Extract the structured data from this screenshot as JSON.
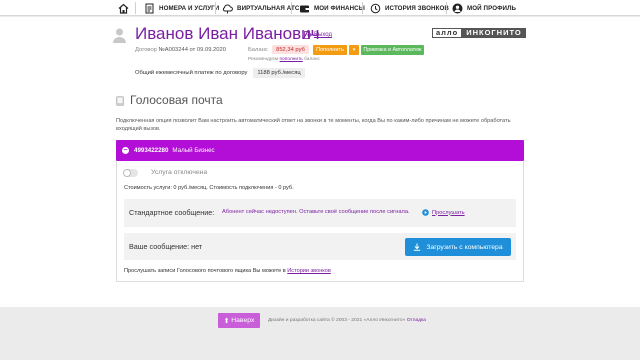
{
  "nav": {
    "home_icon": "home-icon",
    "items": [
      {
        "label": "НОМЕРА И УСЛУГИ",
        "icon": "document-icon"
      },
      {
        "label": "ВИРТУАЛЬНАЯ АТС",
        "icon": "cloud-icon"
      },
      {
        "label": "МОИ ФИНАНСЫ",
        "icon": "wallet-icon"
      },
      {
        "label": "ИСТОРИЯ ЗВОНКОВ",
        "icon": "clock-icon"
      },
      {
        "label": "МОЙ ПРОФИЛЬ",
        "icon": "user-icon"
      }
    ]
  },
  "user": {
    "name": "Иванов Иван Иванович",
    "logout": "Выход",
    "contract_label": "Договор",
    "contract_value": "№A003244 от 09.09.2020",
    "balance_label": "Баланс",
    "balance_value": "852,34 руб",
    "topup_label": "Пополнить",
    "caret": "▾",
    "autopay_label": "Привязка и Автоплатеж",
    "reco_prefix": "Рекомендуем",
    "reco_link": "пополнить",
    "reco_suffix": "баланс",
    "monthly_label": "Общий ежемесячный платеж по договору",
    "monthly_value": "1188 руб./месяц"
  },
  "logo": {
    "part1": "алло",
    "part2": "ИНКОГНИТО"
  },
  "page": {
    "title": "Голосовая почта",
    "description": "Подключенная опция позволит Вам настроить автоматический ответ на звонки в те моменты, когда Вы по каким-либо причинам не можете обработать входящий вызов."
  },
  "service": {
    "phone": "4993422280",
    "plan": "Малый Бизнес",
    "status": "Услуга отключена",
    "toggle_on": false,
    "cost_text": "Стоимость услуги: 0 руб./месяц. Стоимость подключения - 0 руб.",
    "standard_label": "Стандартное сообщение:",
    "standard_message": "Абонент сейчас недоступен. Оставьте своё сообщение после сигнала.",
    "listen_label": "Прослушать",
    "your_label": "Ваше сообщение: нет",
    "upload_label": "Загрузить с компьютера",
    "history_prefix": "Прослушать записи Голосового почтового ящика Вы можете в",
    "history_link": "Истории звонков"
  },
  "footer": {
    "top_button": "Наверх",
    "text": "Дизайн и разработка сайта © 2003 - 2021 «Алло Инкогнито»",
    "link": "Отладка"
  },
  "colors": {
    "brand": "#7b1fa2",
    "bar": "#b20ed7",
    "upload": "#1e8fd8",
    "orange": "#f39c12",
    "green": "#5cb85c"
  }
}
